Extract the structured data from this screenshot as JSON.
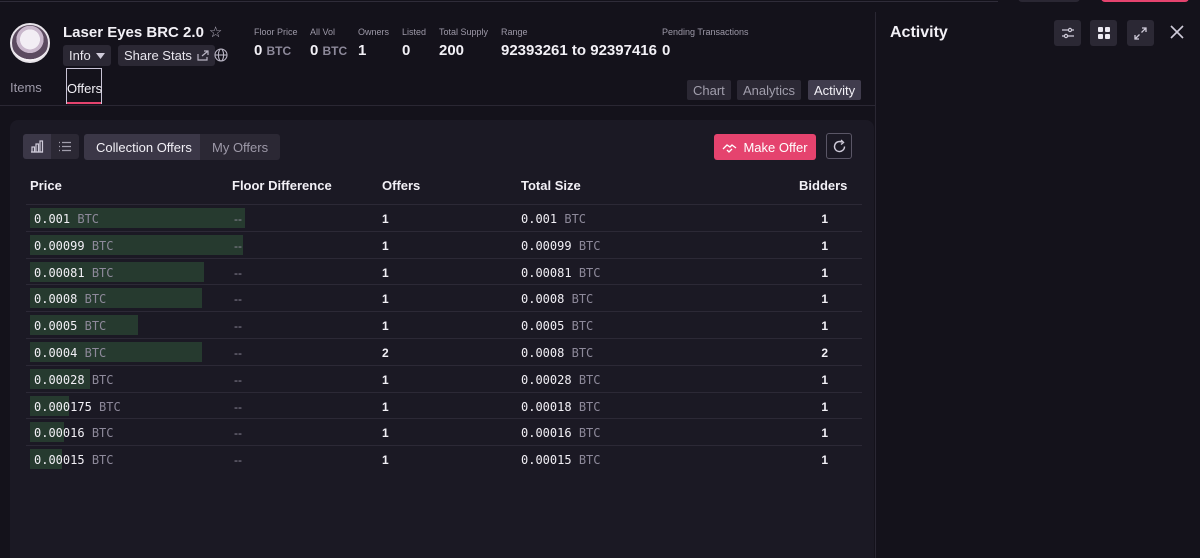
{
  "collection": {
    "name": "Laser Eyes BRC 2.0",
    "info_label": "Info",
    "share_label": "Share Stats"
  },
  "stats": {
    "floor_price": {
      "label": "Floor Price",
      "value": "0",
      "unit": "BTC"
    },
    "all_vol": {
      "label": "All Vol",
      "value": "0",
      "unit": "BTC"
    },
    "owners": {
      "label": "Owners",
      "value": "1"
    },
    "listed": {
      "label": "Listed",
      "value": "0"
    },
    "total_supply": {
      "label": "Total Supply",
      "value": "200"
    },
    "range": {
      "label": "Range",
      "value": "92393261 to 92397416"
    },
    "pending": {
      "label": "Pending Transactions",
      "value": "0"
    }
  },
  "tabs": {
    "items": "Items",
    "offers": "Offers"
  },
  "view_tabs": {
    "chart": "Chart",
    "analytics": "Analytics",
    "activity": "Activity"
  },
  "offers": {
    "segment_collection": "Collection Offers",
    "segment_mine": "My Offers",
    "make_offer": "Make Offer",
    "columns": {
      "price": "Price",
      "floor_diff": "Floor Difference",
      "offers": "Offers",
      "total_size": "Total Size",
      "bidders": "Bidders"
    },
    "unit": "BTC",
    "rows": [
      {
        "price": "0.001",
        "floor_diff": "--",
        "offers": "1",
        "total": "0.001",
        "bidders": "1",
        "depth": 1.0
      },
      {
        "price": "0.00099",
        "floor_diff": "--",
        "offers": "1",
        "total": "0.00099",
        "bidders": "1",
        "depth": 0.99
      },
      {
        "price": "0.00081",
        "floor_diff": "--",
        "offers": "1",
        "total": "0.00081",
        "bidders": "1",
        "depth": 0.81
      },
      {
        "price": "0.0008",
        "floor_diff": "--",
        "offers": "1",
        "total": "0.0008",
        "bidders": "1",
        "depth": 0.8
      },
      {
        "price": "0.0005",
        "floor_diff": "--",
        "offers": "1",
        "total": "0.0005",
        "bidders": "1",
        "depth": 0.5
      },
      {
        "price": "0.0004",
        "floor_diff": "--",
        "offers": "2",
        "total": "0.0008",
        "bidders": "2",
        "depth": 0.8
      },
      {
        "price": "0.00028",
        "floor_diff": "--",
        "offers": "1",
        "total": "0.00028",
        "bidders": "1",
        "depth": 0.28
      },
      {
        "price": "0.000175",
        "floor_diff": "--",
        "offers": "1",
        "total": "0.00018",
        "bidders": "1",
        "depth": 0.18
      },
      {
        "price": "0.00016",
        "floor_diff": "--",
        "offers": "1",
        "total": "0.00016",
        "bidders": "1",
        "depth": 0.16
      },
      {
        "price": "0.00015",
        "floor_diff": "--",
        "offers": "1",
        "total": "0.00015",
        "bidders": "1",
        "depth": 0.15
      }
    ]
  },
  "activity_panel": {
    "title": "Activity"
  },
  "colors": {
    "accent": "#e5436e",
    "depth_bar": "#263a2f",
    "background": "#14121b"
  }
}
